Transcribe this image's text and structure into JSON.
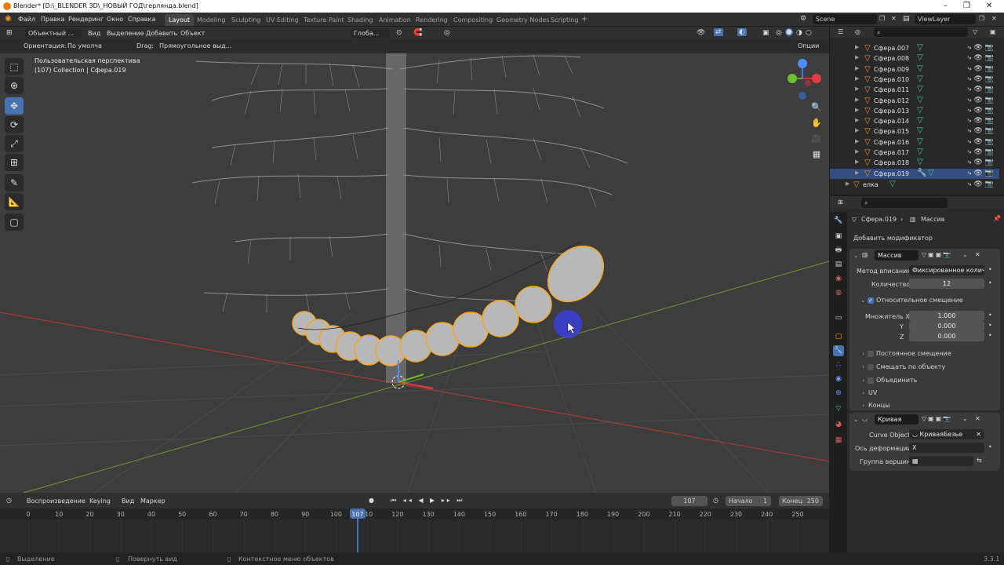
{
  "window": {
    "title": "Blender* [D:\\_BLENDER 3D\\_НОВЫЙ ГОД\\герлянда.blend]"
  },
  "menu": {
    "items": [
      "Файл",
      "Правка",
      "Рендеринг",
      "Окно",
      "Справка"
    ]
  },
  "workspaces": {
    "tabs": [
      "Layout",
      "Modeling",
      "Sculpting",
      "UV Editing",
      "Texture Paint",
      "Shading",
      "Animation",
      "Rendering",
      "Compositing",
      "Geometry Nodes",
      "Scripting"
    ],
    "active": "Layout",
    "add": "+"
  },
  "scene": {
    "name": "Scene",
    "view_layer": "ViewLayer"
  },
  "viewport_header": {
    "mode": "Объектный ...",
    "view": "Вид",
    "select": "Выделение",
    "add": "Добавить",
    "object": "Объект",
    "transform": "Глоба..."
  },
  "tool_settings": {
    "orientation_label": "Ориентация:",
    "orientation_value": "По умолча",
    "drag_label": "Drag:",
    "drag_value": "Прямоугольное выд...",
    "options": "Опции"
  },
  "viewport": {
    "perspective": "Пользовательская перспектива",
    "collection_info": "(107) Collection | Сфера.019"
  },
  "outliner": {
    "rows": [
      {
        "name": "Сфера.007",
        "selected": false
      },
      {
        "name": "Сфера.008",
        "selected": false
      },
      {
        "name": "Сфера.009",
        "selected": false
      },
      {
        "name": "Сфера.010",
        "selected": false
      },
      {
        "name": "Сфера.011",
        "selected": false
      },
      {
        "name": "Сфера.012",
        "selected": false
      },
      {
        "name": "Сфера.013",
        "selected": false
      },
      {
        "name": "Сфера.014",
        "selected": false
      },
      {
        "name": "Сфера.015",
        "selected": false
      },
      {
        "name": "Сфера.016",
        "selected": false
      },
      {
        "name": "Сфера.017",
        "selected": false
      },
      {
        "name": "Сфера.018",
        "selected": false
      },
      {
        "name": "Сфера.019",
        "selected": true
      }
    ],
    "tree_object": "елка"
  },
  "properties": {
    "breadcrumb_object": "Сфера.019",
    "breadcrumb_modifier": "Массив",
    "add_modifier": "Добавить модификатор",
    "array": {
      "name": "Массив",
      "fit_label": "Метод вписания",
      "fit_value": "Фиксированное количе...",
      "count_label": "Количество",
      "count_value": "12",
      "relative_offset": "Относительное смещение",
      "factor_x_label": "Множитель X",
      "factor_x": "1.000",
      "y_label": "Y",
      "factor_y": "0.000",
      "z_label": "Z",
      "factor_z": "0.000",
      "constant_offset": "Постоянное смещение",
      "object_offset": "Смещать по объекту",
      "merge": "Объединить",
      "uv": "UV",
      "caps": "Концы"
    },
    "curve": {
      "name": "Кривая",
      "object_label": "Curve Object",
      "object_value": "КриваяБезье",
      "axis_label": "Ось деформации",
      "axis_value": "X",
      "vgroup_label": "Группа вершин"
    }
  },
  "timeline": {
    "playback": "Воспроизведение",
    "keying": "Keying",
    "view": "Вид",
    "marker": "Маркер",
    "current_frame": "107",
    "start_label": "Начало",
    "start": "1",
    "end_label": "Конец",
    "end": "250",
    "ticks": [
      "0",
      "10",
      "20",
      "30",
      "40",
      "50",
      "60",
      "70",
      "80",
      "90",
      "100",
      "110",
      "120",
      "130",
      "140",
      "150",
      "160",
      "170",
      "180",
      "190",
      "200",
      "210",
      "220",
      "230",
      "240",
      "250"
    ]
  },
  "status": {
    "select": "Выделение",
    "rotate": "Повернуть вид",
    "context": "Контекстное меню объектов",
    "version": "3.3.1"
  },
  "colors": {
    "accent": "#4772b3",
    "selection_orange": "#f5a623",
    "mesh_green": "#3fcf9a",
    "viewport_bg": "#3d3d3d"
  }
}
